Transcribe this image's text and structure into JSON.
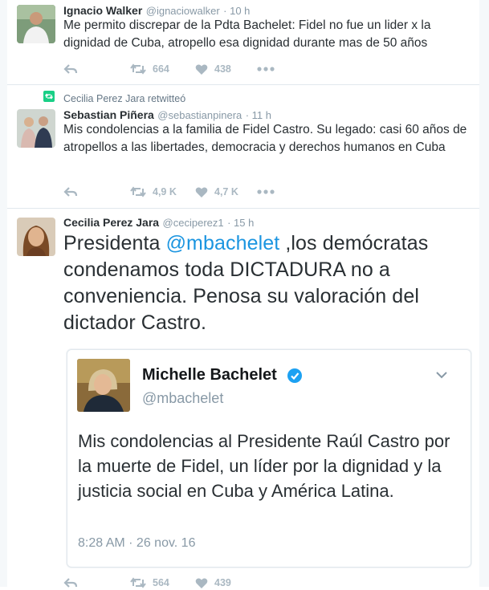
{
  "tweets": [
    {
      "name": "Ignacio Walker",
      "handle": "@ignaciowalker",
      "time": "· 10 h",
      "text": "Me permito discrepar de la Pdta Bachelet: Fidel no fue un lider x la dignidad de Cuba, atropello esa dignidad durante mas de 50 años",
      "retweets": "664",
      "likes": "438"
    },
    {
      "retweeted_by": "Cecilia Perez Jara retwitteó",
      "name": "Sebastian Piñera",
      "handle": "@sebastianpinera",
      "time": "· 11 h",
      "text": "Mis condolencias a la familia de Fidel Castro. Su legado: casi 60 años de atropellos a las libertades, democracia y derechos humanos en Cuba",
      "retweets": "4,9 K",
      "likes": "4,7 K"
    },
    {
      "name": "Cecilia Perez Jara",
      "handle": "@ceciperez1",
      "time": "· 15 h",
      "text_before": "Presidenta ",
      "mention": "@mbachelet",
      "text_after": " ,los demócratas condenamos toda DICTADURA no a conveniencia. Penosa su valoración del dictador Castro.",
      "retweets": "564",
      "likes": "439"
    }
  ],
  "quoted": {
    "name": "Michelle Bachelet",
    "handle": "@mbachelet",
    "text": "Mis condolencias al Presidente Raúl Castro por la muerte de Fidel, un líder por la dignidad y la justicia social en Cuba y América Latina.",
    "time": "8:28 AM · 26 nov. 16"
  },
  "colors": {
    "retweet_green": "#19cf86",
    "verified_blue": "#1da1f2",
    "mention_blue": "#1b95e0"
  }
}
